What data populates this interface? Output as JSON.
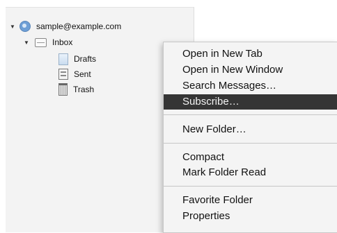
{
  "folder_tree": {
    "account": {
      "label": "sample@example.com",
      "icon": "account-globe-icon",
      "expanded": true
    },
    "inbox": {
      "label": "Inbox",
      "icon": "inbox-tray-icon",
      "expanded": true
    },
    "folders": [
      {
        "label": "Drafts",
        "icon": "drafts-icon"
      },
      {
        "label": "Sent",
        "icon": "sent-icon"
      },
      {
        "label": "Trash",
        "icon": "trash-icon"
      }
    ]
  },
  "context_menu": {
    "groups": [
      [
        "Open in New Tab",
        "Open in New Window",
        "Search Messages…",
        "Subscribe…"
      ],
      [
        "New Folder…"
      ],
      [
        "Compact",
        "Mark Folder Read"
      ],
      [
        "Favorite Folder",
        "Properties"
      ]
    ],
    "highlighted_item": "Subscribe…",
    "highlight_color": "#353535"
  }
}
